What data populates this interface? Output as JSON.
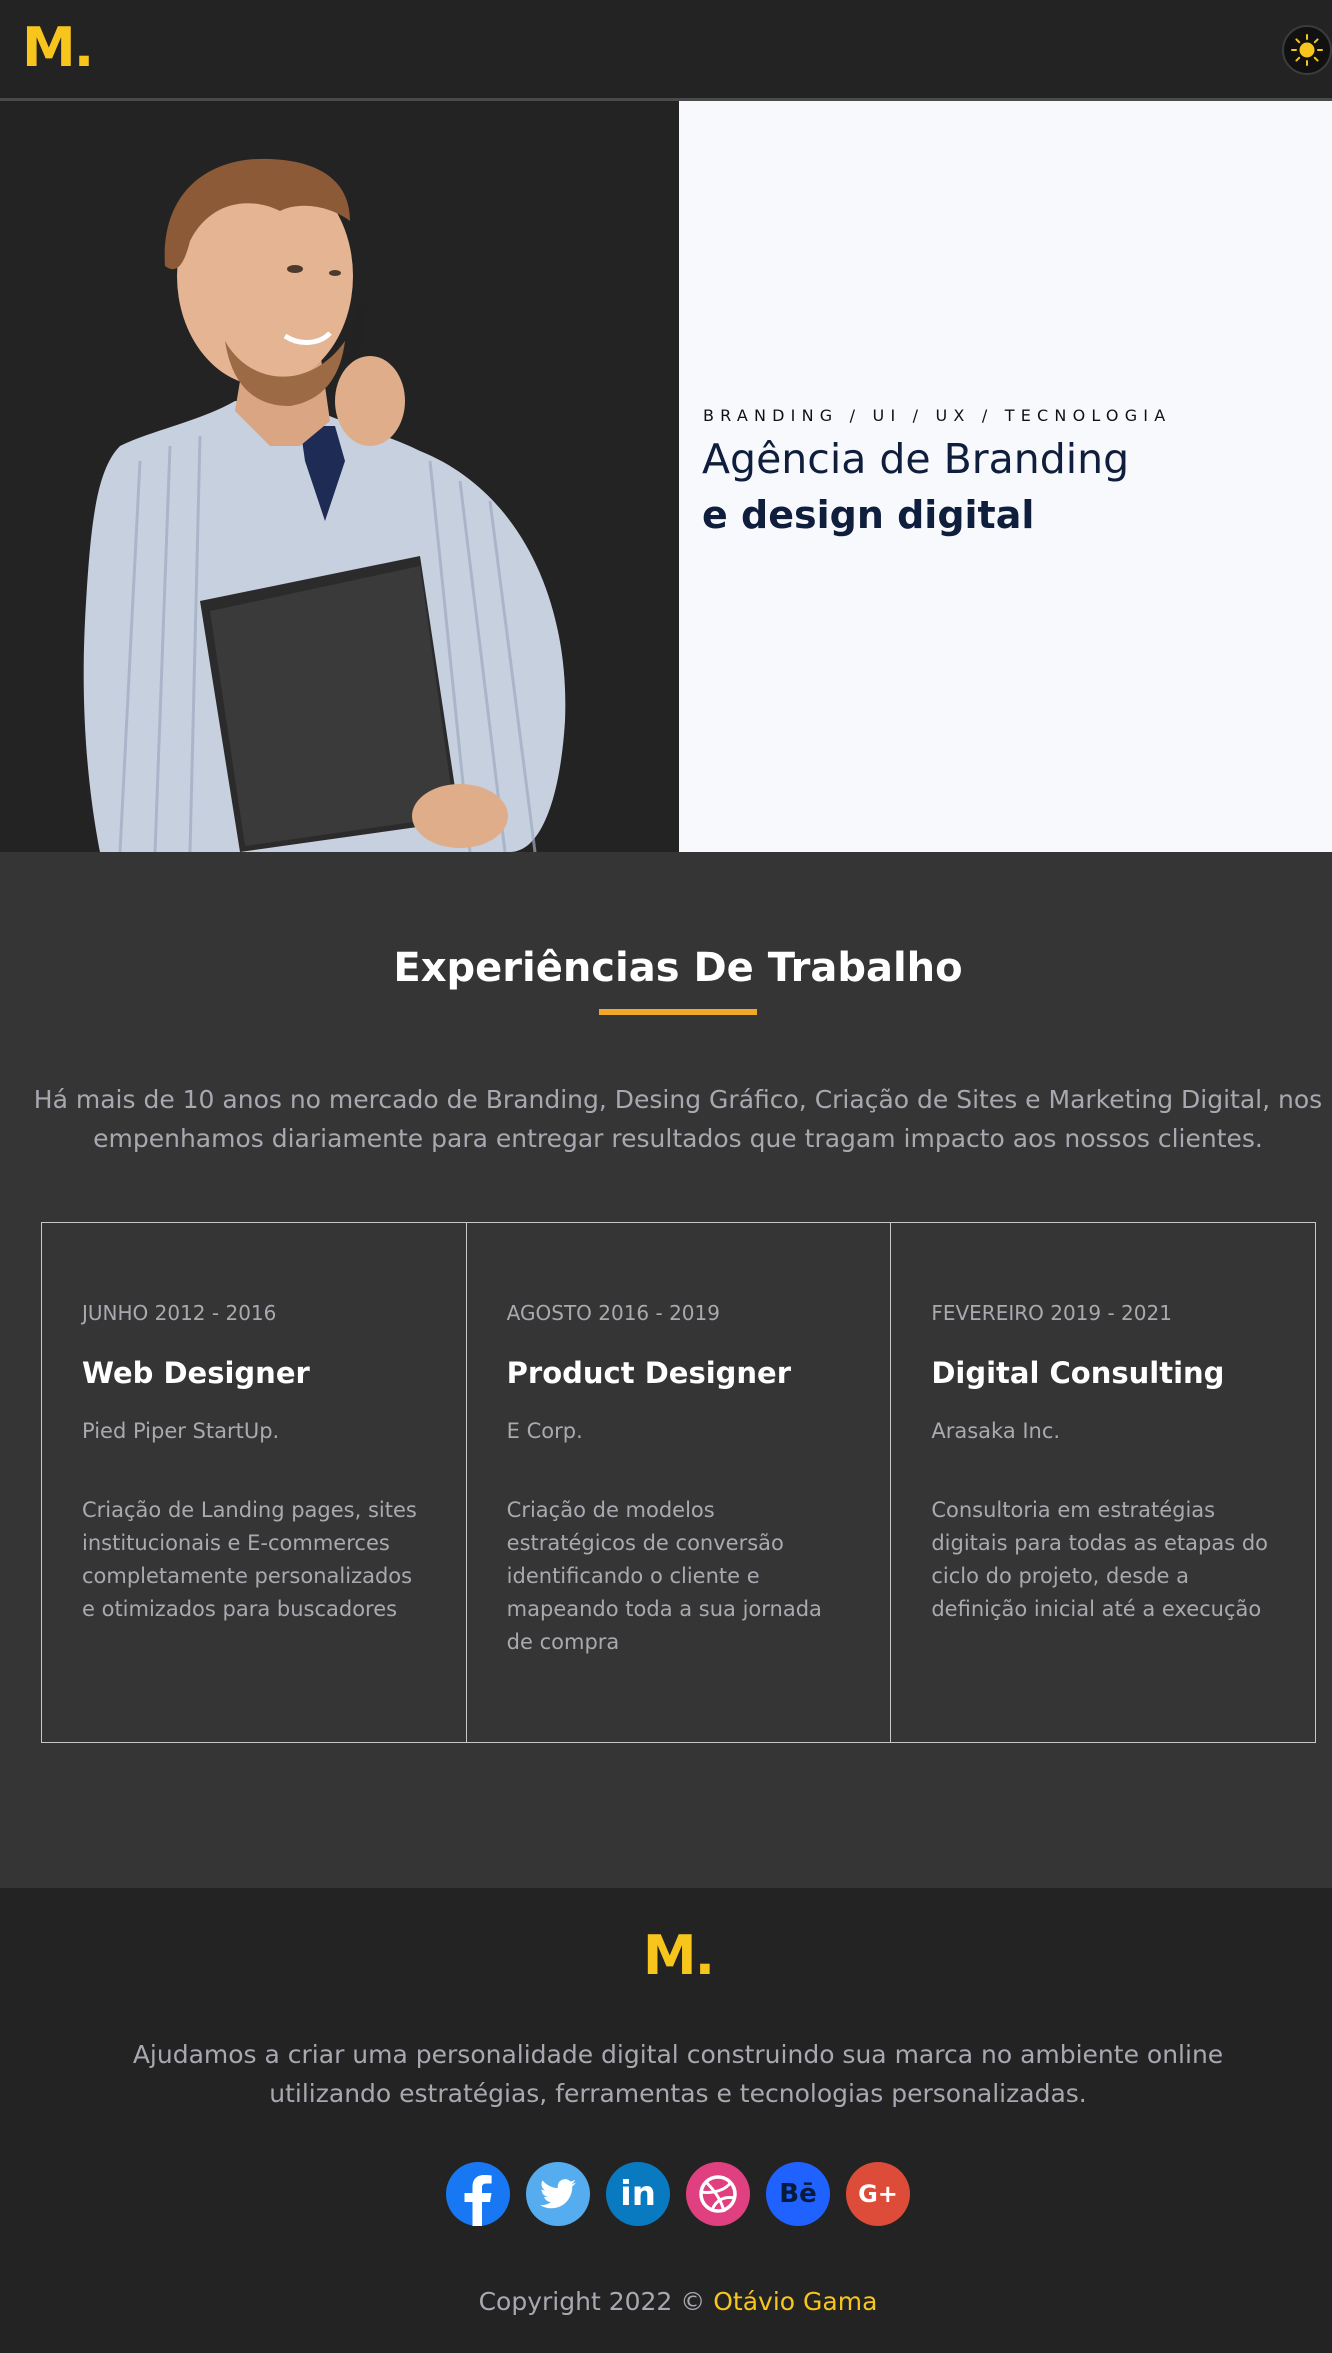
{
  "header": {
    "logo": "M.",
    "theme_toggle_icon": "sun-icon"
  },
  "hero": {
    "image_description_icon": "person-photo",
    "tags": "BRANDING / UI / UX / TECNOLOGIA",
    "title_line1": "Agência de Branding",
    "title_line2": "e design digital"
  },
  "experience": {
    "title": "Experiências De Trabalho",
    "intro": "Há mais de 10 anos no mercado de Branding, Desing Gráfico, Criação de Sites e Marketing Digital, nos empenhamos diariamente para entregar resultados que tragam impacto aos nossos clientes.",
    "jobs": [
      {
        "date": "JUNHO 2012 - 2016",
        "role": "Web Designer",
        "company": "Pied Piper StartUp.",
        "description": "Criação de Landing pages, sites institucionais e E-commerces completamente personalizados e otimizados para buscadores"
      },
      {
        "date": "AGOSTO 2016 - 2019",
        "role": "Product Designer",
        "company": "E Corp.",
        "description": "Criação de modelos estratégicos de conversão identificando o cliente e mapeando toda a sua jornada de compra"
      },
      {
        "date": "FEVEREIRO 2019 - 2021",
        "role": "Digital Consulting",
        "company": "Arasaka Inc.",
        "description": "Consultoria em estratégias digitais para todas as etapas do ciclo do projeto, desde a definição inicial até a execução"
      }
    ]
  },
  "footer": {
    "logo": "M.",
    "text": "Ajudamos a criar uma personalidade digital construindo sua marca no ambiente online utilizando estratégias, ferramentas e tecnologias personalizadas.",
    "socials": [
      {
        "icon": "facebook-icon",
        "color": "#1877f2",
        "glyph": "f"
      },
      {
        "icon": "twitter-icon",
        "color": "#55acee",
        "glyph": ""
      },
      {
        "icon": "linkedin-icon",
        "color": "#0a7ac0",
        "glyph": "in"
      },
      {
        "icon": "dribbble-icon",
        "color": "#e0407f",
        "glyph": ""
      },
      {
        "icon": "behance-icon",
        "color": "#1f62ff",
        "glyph": "Bē"
      },
      {
        "icon": "google-plus-icon",
        "color": "#dd4b39",
        "glyph": "G+"
      }
    ],
    "copyright_prefix": "Copyright 2022 ©",
    "copyright_author": "Otávio Gama"
  },
  "colors": {
    "brand_yellow": "#f7c51c",
    "accent_underline": "#f1a72a",
    "navy": "#0f1e3c"
  }
}
